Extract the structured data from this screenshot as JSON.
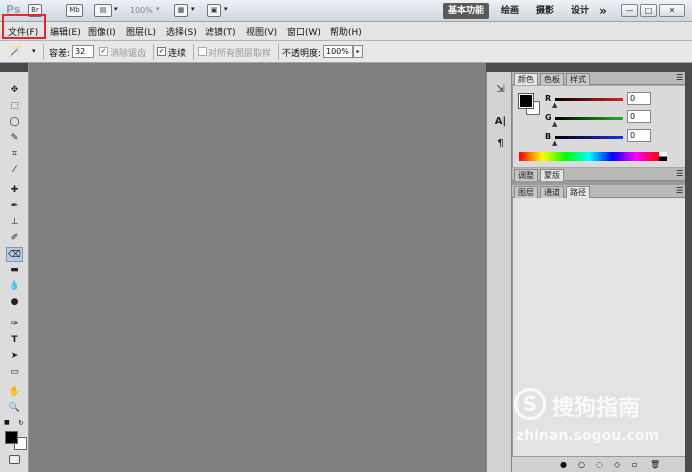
{
  "titlebar": {
    "app_logo": "Ps",
    "mb_label": "Mb",
    "zoom": "100%",
    "workspaces": [
      "基本功能",
      "绘画",
      "摄影",
      "设计"
    ],
    "more": "»",
    "window_buttons": [
      "—",
      "□",
      "✕"
    ]
  },
  "menubar": {
    "items": [
      "文件(F)",
      "编辑(E)",
      "图像(I)",
      "图层(L)",
      "选择(S)",
      "滤镜(T)",
      "视图(V)",
      "窗口(W)",
      "帮助(H)"
    ]
  },
  "options": {
    "tolerance_label": "容差:",
    "tolerance_value": "32",
    "antialias_label": "消除锯齿",
    "contiguous_label": "连续",
    "all_layers_label": "对所有图层取样",
    "opacity_label": "不透明度:",
    "opacity_value": "100%"
  },
  "color_panel": {
    "tabs": [
      "颜色",
      "色板",
      "样式"
    ],
    "channels": [
      {
        "label": "R",
        "value": "0",
        "color": "#cc1b1b"
      },
      {
        "label": "G",
        "value": "0",
        "color": "#1ea81e"
      },
      {
        "label": "B",
        "value": "0",
        "color": "#1b2ccc"
      }
    ]
  },
  "adjust_panel": {
    "tabs": [
      "调整",
      "蒙版"
    ]
  },
  "layers_panel": {
    "tabs": [
      "图层",
      "通道",
      "路径"
    ]
  },
  "watermark": {
    "brand": "搜狗指南",
    "url": "zhinan.sogou.com"
  },
  "colors": {
    "highlight": "#e8242c",
    "canvas": "#7f7f7f"
  }
}
